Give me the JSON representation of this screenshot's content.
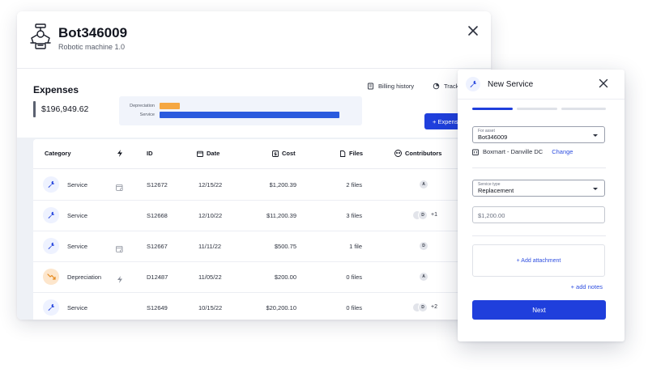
{
  "asset": {
    "title": "Bot346009",
    "subtitle": "Robotic machine 1.0"
  },
  "expenses": {
    "title": "Expenses",
    "total": "$196,949.62",
    "links": {
      "billing_history": "Billing history",
      "track": "Track"
    },
    "add_button": "+ Expense"
  },
  "chart_data": {
    "type": "bar",
    "orientation": "horizontal",
    "categories": [
      "Depreciation",
      "Service"
    ],
    "values": [
      20200.1,
      176749.52
    ],
    "colors": [
      "#f5a742",
      "#2b5bde"
    ]
  },
  "table": {
    "headers": {
      "category": "Category",
      "id": "ID",
      "date": "Date",
      "cost": "Cost",
      "files": "Files",
      "contributors": "Contributors"
    },
    "rows": [
      {
        "category": "Service",
        "type_icon": "calendar-icon",
        "id": "S12672",
        "date": "12/15/22",
        "cost": "$1,200.39",
        "files": "2 files",
        "avatars": [
          "A"
        ],
        "extra": ""
      },
      {
        "category": "Service",
        "type_icon": "",
        "id": "S12668",
        "date": "12/10/22",
        "cost": "$11,200.39",
        "files": "3 files",
        "avatars": [
          "",
          "D"
        ],
        "extra": "+1"
      },
      {
        "category": "Service",
        "type_icon": "calendar-icon",
        "id": "S12667",
        "date": "11/11/22",
        "cost": "$500.75",
        "files": "1 file",
        "avatars": [
          "D"
        ],
        "extra": ""
      },
      {
        "category": "Depreciation",
        "type_icon": "bolt-icon",
        "id": "D12487",
        "date": "11/05/22",
        "cost": "$200.00",
        "files": "0 files",
        "avatars": [
          "A"
        ],
        "extra": ""
      },
      {
        "category": "Service",
        "type_icon": "",
        "id": "S12649",
        "date": "10/15/22",
        "cost": "$20,200.10",
        "files": "0 files",
        "avatars": [
          "",
          "D"
        ],
        "extra": "+2"
      }
    ]
  },
  "panel": {
    "title": "New Service",
    "steps_total": 3,
    "steps_active": 1,
    "for_asset_label": "For asset",
    "for_asset_value": "Bot346009",
    "location": "Boxmart - Danville DC",
    "change": "Change",
    "service_type_label": "Service type",
    "service_type_value": "Replacement",
    "amount_placeholder": "$1,200.00",
    "add_attachment": "+ Add attachment",
    "add_notes": "+ add notes",
    "next": "Next"
  },
  "colors": {
    "accent": "#1f3fdc",
    "depreciation": "#f5a742",
    "service": "#2b5bde"
  }
}
